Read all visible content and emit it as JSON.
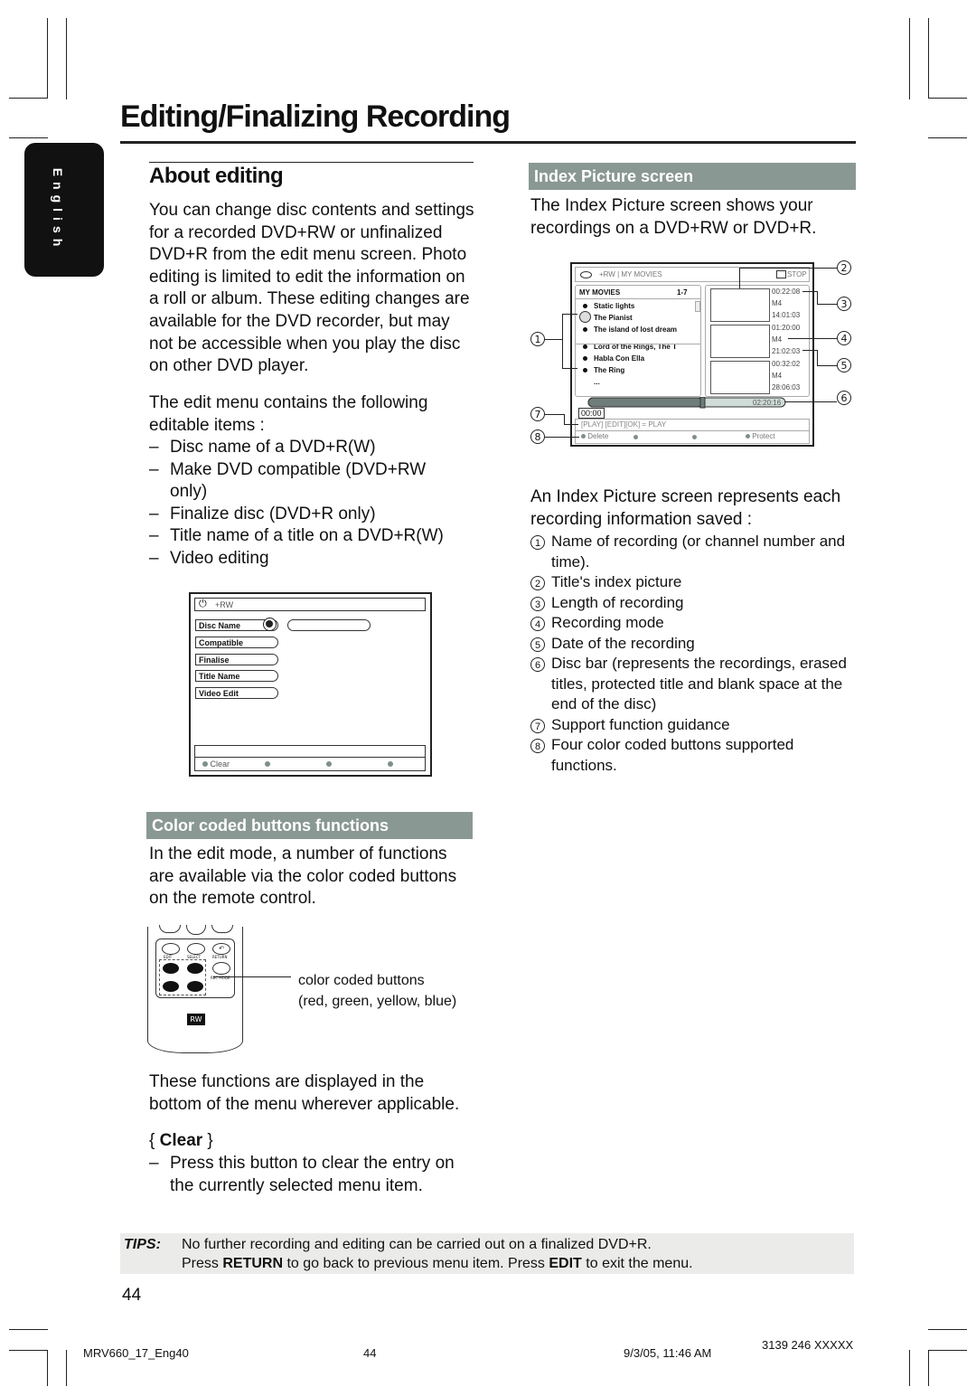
{
  "page": {
    "title": "Editing/Finalizing Recording",
    "language_tab": "English",
    "page_number": "44"
  },
  "about_editing": {
    "heading": "About editing",
    "intro": "You can change disc contents and settings for a recorded DVD+RW or unfinalized DVD+R from the edit menu screen. Photo editing is limited to edit the information on a roll or album. These editing changes are available for the DVD recorder, but may not be accessible when you play the disc on other DVD player.",
    "list_intro": "The edit menu contains the following editable items :",
    "items": [
      "Disc name of a DVD+R(W)",
      "Make DVD compatible (DVD+RW only)",
      "Finalize disc (DVD+R only)",
      "Title name of a title on a DVD+R(W)",
      "Video editing"
    ]
  },
  "edit_menu_screen": {
    "header": "+RW",
    "menu_items": [
      "Disc Name",
      "Compatible",
      "Finalise",
      "Title Name",
      "Video Edit"
    ],
    "color_buttons": [
      "Clear",
      "",
      "",
      ""
    ]
  },
  "color_coded": {
    "heading": "Color coded buttons functions",
    "intro": "In the edit mode, a number of functions are available via the color coded buttons on the remote control.",
    "remote_labels": [
      "EDIT",
      "SELECT",
      "RETURN",
      "REC MODE"
    ],
    "callout_line1": "color coded buttons",
    "callout_line2": "(red, green, yellow, blue)",
    "displayed_text": "These functions are displayed in the bottom of the menu wherever applicable.",
    "clear_heading": "{ Clear }",
    "clear_label": "Clear",
    "clear_desc": "Press this button to clear the entry on the currently selected menu item."
  },
  "index_picture": {
    "heading": "Index Picture screen",
    "intro": "The Index Picture screen shows your recordings on a DVD+RW or DVD+R.",
    "screen": {
      "header": "+RW | MY MOVIES",
      "stop_label": "STOP",
      "list_title": "MY MOVIES",
      "list_range": "1-7",
      "titles": [
        "Static lights",
        "The Pianist",
        "The island of lost dream",
        "Lord of the Rings, The T",
        "Habla Con Ella",
        "The Ring",
        "..."
      ],
      "thumbs": [
        {
          "length": "00:22:08",
          "mode": "M4",
          "date": "14:01:03"
        },
        {
          "length": "01:20:00",
          "mode": "M4",
          "date": "21:02:03"
        },
        {
          "length": "00:32:02",
          "mode": "M4",
          "date": "28:06:03"
        }
      ],
      "disc_bar_fill": 0.58,
      "disc_total": "02:20:16",
      "disc_start": "00:00",
      "guidance": "[PLAY] [EDIT][OK] = PLAY",
      "color_buttons": [
        "Delete",
        "",
        "",
        "Protect"
      ]
    },
    "callouts": [
      "1",
      "2",
      "3",
      "4",
      "5",
      "6",
      "7",
      "8"
    ],
    "represents_intro": "An Index Picture screen represents each recording information saved :",
    "legend": [
      {
        "n": "1",
        "text": "Name of recording (or channel number and time)."
      },
      {
        "n": "2",
        "text": "Title's index picture"
      },
      {
        "n": "3",
        "text": "Length of recording"
      },
      {
        "n": "4",
        "text": "Recording mode"
      },
      {
        "n": "5",
        "text": "Date of the recording"
      },
      {
        "n": "6",
        "text": "Disc bar (represents the recordings, erased titles, protected title and blank space at the end of the disc)"
      },
      {
        "n": "7",
        "text": "Support function guidance"
      },
      {
        "n": "8",
        "text": "Four color coded buttons supported functions."
      }
    ]
  },
  "tips": {
    "label": "TIPS:",
    "line1": "No further recording and editing can be carried out on a finalized DVD+R.",
    "line2_a": "Press ",
    "line2_b": "RETURN",
    "line2_c": " to go back to previous menu item.  Press ",
    "line2_d": "EDIT",
    "line2_e": " to exit the menu."
  },
  "footer": {
    "file": "MRV660_17_Eng40",
    "page": "44",
    "date": "9/3/05, 11:46 AM",
    "code": "3139 246 XXXXX"
  }
}
